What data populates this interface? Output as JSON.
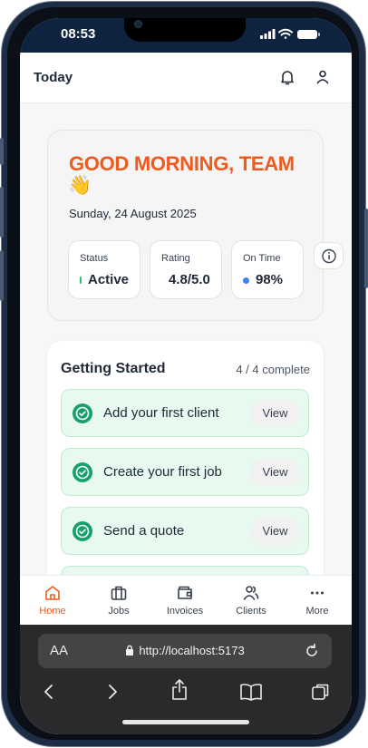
{
  "status_bar": {
    "time": "08:53"
  },
  "header": {
    "title": "Today"
  },
  "greeting": {
    "title": "GOOD MORNING, TEAM",
    "emoji": "👋",
    "date": "Sunday, 24 August 2025"
  },
  "stats": [
    {
      "label": "Status",
      "value": "Active",
      "indicator_color": "#22c55e"
    },
    {
      "label": "Rating",
      "value": "4.8/5.0"
    },
    {
      "label": "On Time",
      "value": "98%",
      "indicator_color": "#3b82f6"
    }
  ],
  "getting_started": {
    "title": "Getting Started",
    "progress": "4 / 4 complete",
    "tasks": [
      {
        "label": "Add your first client",
        "button": "View"
      },
      {
        "label": "Create your first job",
        "button": "View"
      },
      {
        "label": "Send a quote",
        "button": "View"
      }
    ]
  },
  "tabs": [
    {
      "label": "Home",
      "icon": "home-icon",
      "active": true
    },
    {
      "label": "Jobs",
      "icon": "briefcase-icon"
    },
    {
      "label": "Invoices",
      "icon": "wallet-icon"
    },
    {
      "label": "Clients",
      "icon": "users-icon"
    },
    {
      "label": "More",
      "icon": "more-icon"
    }
  ],
  "browser": {
    "text_size": "AA",
    "url": "http://localhost:5173"
  },
  "colors": {
    "accent": "#ef5a1e",
    "success": "#16a06b",
    "task_bg": "#e8f9ef",
    "status_bar_bg": "#0e2340"
  }
}
